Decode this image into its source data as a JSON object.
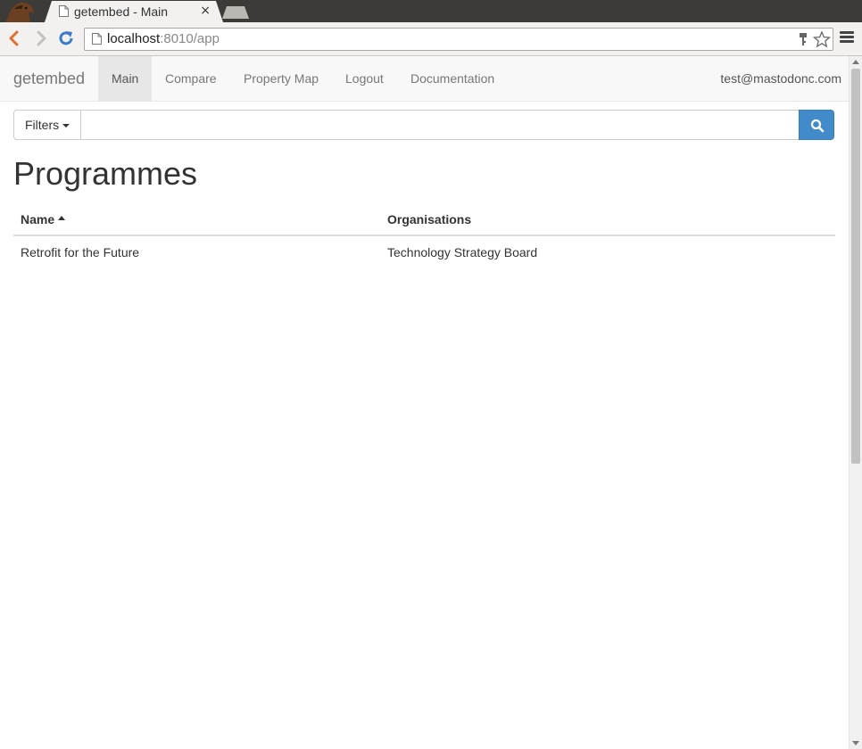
{
  "browser": {
    "tab_title": "getembed - Main",
    "tab_close": "×",
    "url_host": "localhost",
    "url_rest": ":8010/app"
  },
  "navbar": {
    "brand": "getembed",
    "items": [
      {
        "label": "Main",
        "active": true
      },
      {
        "label": "Compare",
        "active": false
      },
      {
        "label": "Property Map",
        "active": false
      },
      {
        "label": "Logout",
        "active": false
      },
      {
        "label": "Documentation",
        "active": false
      }
    ],
    "user_email": "test@mastodonc.com"
  },
  "search": {
    "filters_label": "Filters",
    "query": "",
    "placeholder": ""
  },
  "main": {
    "title": "Programmes",
    "table": {
      "columns": [
        "Name",
        "Organisations"
      ],
      "sort_column": "Name",
      "rows": [
        [
          "Retrofit for the Future",
          "Technology Strategy Board"
        ]
      ]
    }
  },
  "colors": {
    "primary": "#428bca",
    "navbar_bg": "#f8f8f8",
    "nav_active_bg": "#e7e7e7"
  }
}
